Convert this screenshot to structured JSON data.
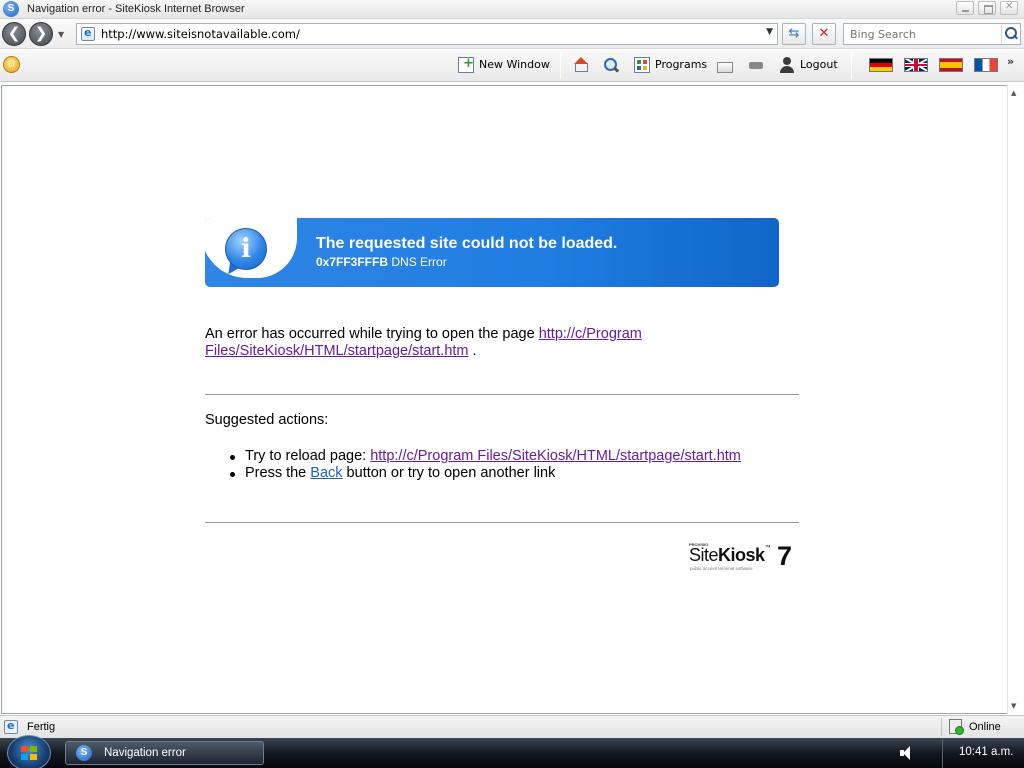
{
  "window": {
    "title": "Navigation error - SiteKiosk Internet Browser"
  },
  "navigation": {
    "back_symbol": "❮",
    "forward_symbol": "❯",
    "address": "http://www.siteisnotavailable.com/",
    "refresh_symbol": "⇆",
    "stop_symbol": "✕",
    "search_placeholder": "Bing Search"
  },
  "toolbar": {
    "new_window": "New Window",
    "programs": "Programs",
    "logout": "Logout",
    "favorites_symbol": "✩",
    "overflow_symbol": "»",
    "languages": [
      "German",
      "English",
      "Spanish",
      "French"
    ]
  },
  "page": {
    "banner": {
      "heading": "The requested site could not be loaded.",
      "error_code": "0x7FF3FFFB",
      "error_text": "DNS Error",
      "info_symbol": "i"
    },
    "error_message": {
      "prefix": "An error has occurred while trying to open the page ",
      "link": "http://c/Program Files/SiteKiosk/HTML/startpage/start.htm",
      "suffix": " ."
    },
    "suggested_title": "Suggested actions:",
    "actions": {
      "reload_prefix": "Try to reload page: ",
      "reload_link": "http://c/Program Files/SiteKiosk/HTML/startpage/start.htm",
      "back_prefix": "Press the ",
      "back_link": "Back",
      "back_suffix": " button or try to open another link"
    },
    "logo": {
      "small_text": "PROVISIO",
      "name_light": "Site",
      "name_bold": "Kiosk",
      "tm": "™",
      "version": "7",
      "tagline": "public access terminal software"
    }
  },
  "statusbar": {
    "status": "Fertig",
    "zone": "Online"
  },
  "taskbar": {
    "task_label": "Navigation error",
    "time": "10:41 a.m."
  }
}
